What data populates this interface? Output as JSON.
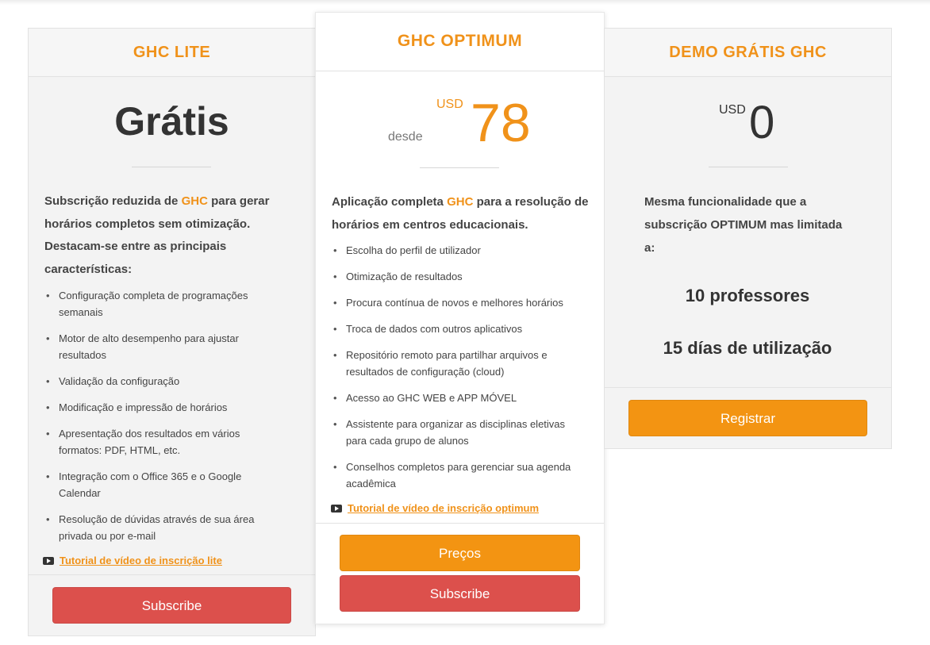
{
  "lite": {
    "title": "GHC LITE",
    "price": "Grátis",
    "desc_pre": "Subscrição reduzida de ",
    "desc_hl": "GHC",
    "desc_post": " para gerar horários completos sem otimização. Destacam-se entre as principais características:",
    "features": [
      "Configuração completa de programações semanais",
      "Motor de alto desempenho para ajustar resultados",
      "Validação da configuração",
      "Modificação e impressão de horários",
      "Apresentação dos resultados em vários formatos: PDF, HTML, etc.",
      "Integração com o Office 365 e o Google Calendar",
      "Resolução de dúvidas através de sua área privada ou por e-mail"
    ],
    "video_link": "Tutorial de vídeo de inscrição lite",
    "subscribe_label": "Subscribe"
  },
  "optimum": {
    "title": "GHC OPTIMUM",
    "from_label": "desde",
    "currency": "USD",
    "price": "78",
    "desc_pre": "Aplicação completa ",
    "desc_hl": "GHC",
    "desc_post": " para a resolução de horários em centros educacionais.",
    "features": [
      "Escolha do perfil de utilizador",
      "Otimização de resultados",
      "Procura contínua de novos e melhores horários",
      "Troca de dados com outros aplicativos",
      "Repositório remoto para partilhar arquivos e resultados de configuração (cloud)",
      "Acesso ao GHC WEB e APP MÓVEL",
      "Assistente para organizar as disciplinas eletivas para cada grupo de alunos",
      "Conselhos completos para gerenciar sua agenda acadêmica"
    ],
    "video_link": "Tutorial de vídeo de inscrição optimum",
    "prices_label": "Preços",
    "subscribe_label": "Subscribe"
  },
  "demo": {
    "title": "DEMO GRÁTIS GHC",
    "currency": "USD",
    "price": "0",
    "desc": "Mesma funcionalidade que a subscrição OPTIMUM mas limitada a:",
    "limit_teachers": "10 professores",
    "limit_days": "15 días de utilização",
    "register_label": "Registrar"
  },
  "colors": {
    "accent": "#f0921a",
    "subscribe": "#dc504c",
    "button_orange": "#f39412"
  }
}
